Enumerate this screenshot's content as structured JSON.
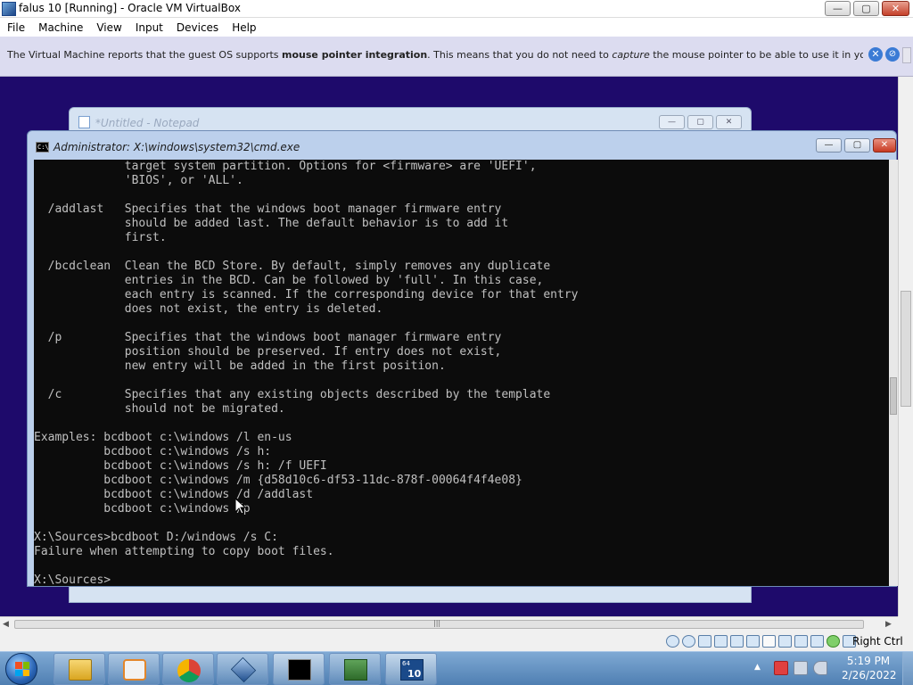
{
  "host_window": {
    "title": "falus 10 [Running] - Oracle VM VirtualBox",
    "icon": "virtualbox-app-icon",
    "controls": {
      "minimize": "—",
      "maximize": "▢",
      "close": "✕"
    }
  },
  "menubar": {
    "items": [
      "File",
      "Machine",
      "View",
      "Input",
      "Devices",
      "Help"
    ]
  },
  "notification": {
    "text_1": "The Virtual Machine reports that the guest OS supports ",
    "bold": "mouse pointer integration",
    "text_2": ". This means that you do not need to ",
    "italic": "capture",
    "text_3": " the mouse pointer to be able to use it in your guest OS -- all mouse",
    "close_glyph": "✕",
    "dismiss_glyph": "⊘"
  },
  "notepad": {
    "title": "*Untitled - Notepad",
    "controls": {
      "minimize": "—",
      "maximize": "▢",
      "close": "✕"
    }
  },
  "cmd": {
    "title": "Administrator: X:\\windows\\system32\\cmd.exe",
    "icon_text": "C:\\",
    "controls": {
      "minimize": "—",
      "maximize": "▢",
      "close": "✕"
    },
    "lines": [
      "             target system partition. Options for <firmware> are 'UEFI',",
      "             'BIOS', or 'ALL'.",
      "",
      "  /addlast   Specifies that the windows boot manager firmware entry",
      "             should be added last. The default behavior is to add it",
      "             first.",
      "",
      "  /bcdclean  Clean the BCD Store. By default, simply removes any duplicate",
      "             entries in the BCD. Can be followed by 'full'. In this case,",
      "             each entry is scanned. If the corresponding device for that entry",
      "             does not exist, the entry is deleted.",
      "",
      "  /p         Specifies that the windows boot manager firmware entry",
      "             position should be preserved. If entry does not exist,",
      "             new entry will be added in the first position.",
      "",
      "  /c         Specifies that any existing objects described by the template",
      "             should not be migrated.",
      "",
      "Examples: bcdboot c:\\windows /l en-us",
      "          bcdboot c:\\windows /s h:",
      "          bcdboot c:\\windows /s h: /f UEFI",
      "          bcdboot c:\\windows /m {d58d10c6-df53-11dc-878f-00064f4f4e08}",
      "          bcdboot c:\\windows /d /addlast",
      "          bcdboot c:\\windows /p",
      "",
      "X:\\Sources>bcdboot D:/windows /s C:",
      "Failure when attempting to copy boot files.",
      "",
      "X:\\Sources>"
    ]
  },
  "host_scrollbars": {
    "left_arrow": "◀",
    "right_arrow": "▶",
    "grip": "|||",
    "vgrip": "≡"
  },
  "vbox_status": {
    "host_key": "Right Ctrl",
    "icons": [
      "hard-disk-icon",
      "optical-drive-icon",
      "audio-icon",
      "network-icon",
      "usb-icon",
      "shared-folders-icon",
      "display-icon",
      "video-capture-icon",
      "recording-icon",
      "cpu-icon",
      "mouse-integration-icon",
      "keyboard-icon"
    ]
  },
  "taskbar": {
    "pinned": [
      "explorer-icon",
      "media-player-icon",
      "chrome-icon",
      "virtualbox-icon",
      "cmd-icon",
      "network-monitor-icon",
      "windows10-vm-icon"
    ],
    "vm_badge_top": "64",
    "vm_badge": "10",
    "tray_overflow": "▲",
    "clock": {
      "time": "5:19 PM",
      "date": "2/26/2022"
    }
  }
}
